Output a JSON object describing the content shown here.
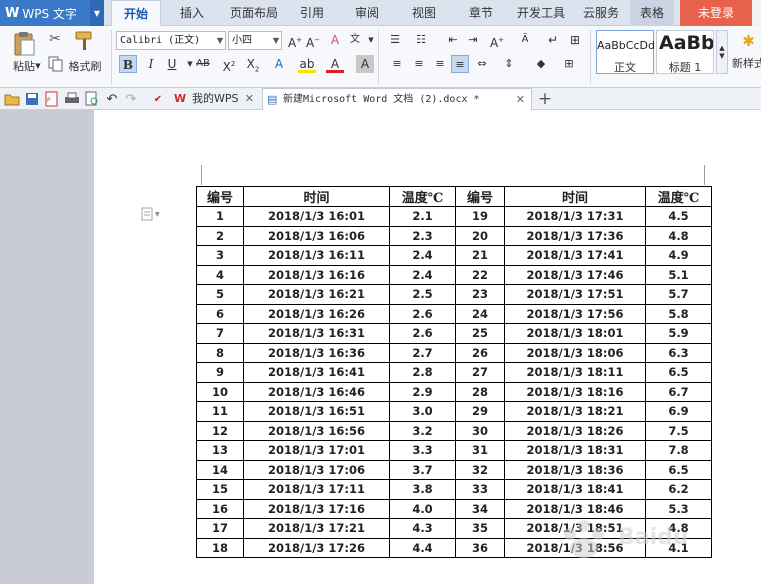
{
  "app": {
    "name": "WPS 文字",
    "login_label": "未登录"
  },
  "menu": {
    "tabs": [
      "开始",
      "插入",
      "页面布局",
      "引用",
      "审阅",
      "视图",
      "章节",
      "开发工具",
      "云服务",
      "表格"
    ],
    "active_index": 0
  },
  "ribbon": {
    "paste_label": "粘贴",
    "format_painter_label": "格式刷",
    "font_name": "Calibri (正文)",
    "font_size": "小四",
    "styles": [
      {
        "sample": "AaBbCcDd",
        "name": "正文"
      },
      {
        "sample": "AaBb",
        "name": "标题 1"
      }
    ],
    "new_style_label": "新样式"
  },
  "tabbar": {
    "tabs": [
      {
        "label": "我的WPS",
        "active": false
      },
      {
        "label": "新建Microsoft Word 文档 (2).docx *",
        "active": true
      }
    ],
    "new_tab_symbol": "+"
  },
  "table": {
    "headers": [
      "编号",
      "时间",
      "温度℃",
      "编号",
      "时间",
      "温度℃"
    ],
    "rows": [
      [
        "1",
        "2018/1/3 16:01",
        "2.1",
        "19",
        "2018/1/3 17:31",
        "4.5"
      ],
      [
        "2",
        "2018/1/3 16:06",
        "2.3",
        "20",
        "2018/1/3 17:36",
        "4.8"
      ],
      [
        "3",
        "2018/1/3 16:11",
        "2.4",
        "21",
        "2018/1/3 17:41",
        "4.9"
      ],
      [
        "4",
        "2018/1/3 16:16",
        "2.4",
        "22",
        "2018/1/3 17:46",
        "5.1"
      ],
      [
        "5",
        "2018/1/3 16:21",
        "2.5",
        "23",
        "2018/1/3 17:51",
        "5.7"
      ],
      [
        "6",
        "2018/1/3 16:26",
        "2.6",
        "24",
        "2018/1/3 17:56",
        "5.8"
      ],
      [
        "7",
        "2018/1/3 16:31",
        "2.6",
        "25",
        "2018/1/3 18:01",
        "5.9"
      ],
      [
        "8",
        "2018/1/3 16:36",
        "2.7",
        "26",
        "2018/1/3 18:06",
        "6.3"
      ],
      [
        "9",
        "2018/1/3 16:41",
        "2.8",
        "27",
        "2018/1/3 18:11",
        "6.5"
      ],
      [
        "10",
        "2018/1/3 16:46",
        "2.9",
        "28",
        "2018/1/3 18:16",
        "6.7"
      ],
      [
        "11",
        "2018/1/3 16:51",
        "3.0",
        "29",
        "2018/1/3 18:21",
        "6.9"
      ],
      [
        "12",
        "2018/1/3 16:56",
        "3.2",
        "30",
        "2018/1/3 18:26",
        "7.5"
      ],
      [
        "13",
        "2018/1/3 17:01",
        "3.3",
        "31",
        "2018/1/3 18:31",
        "7.8"
      ],
      [
        "14",
        "2018/1/3 17:06",
        "3.7",
        "32",
        "2018/1/3 18:36",
        "6.5"
      ],
      [
        "15",
        "2018/1/3 17:11",
        "3.8",
        "33",
        "2018/1/3 18:41",
        "6.2"
      ],
      [
        "16",
        "2018/1/3 17:16",
        "4.0",
        "34",
        "2018/1/3 18:46",
        "5.3"
      ],
      [
        "17",
        "2018/1/3 17:21",
        "4.3",
        "35",
        "2018/1/3 18:51",
        "4.8"
      ],
      [
        "18",
        "2018/1/3 17:26",
        "4.4",
        "36",
        "2018/1/3 18:56",
        "4.1"
      ]
    ]
  },
  "watermark": {
    "text": "Baidu 经验"
  }
}
